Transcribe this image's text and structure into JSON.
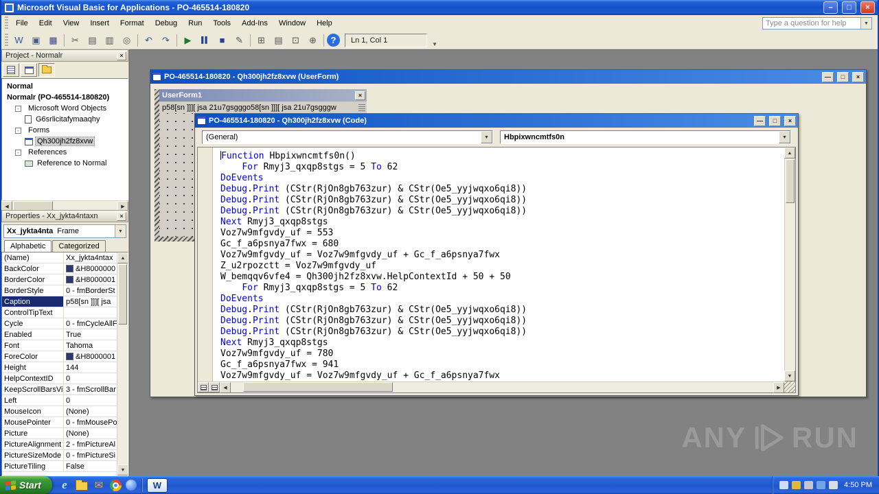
{
  "titlebar": {
    "title": "Microsoft Visual Basic for Applications - PO-465514-180820"
  },
  "menubar": {
    "items": [
      "File",
      "Edit",
      "View",
      "Insert",
      "Format",
      "Debug",
      "Run",
      "Tools",
      "Add-Ins",
      "Window",
      "Help"
    ],
    "help_placeholder": "Type a question for help"
  },
  "toolbar": {
    "caret_position": "Ln 1, Col 1",
    "buttons": [
      {
        "name": "view-host-application-button",
        "glyph": "W",
        "color": "#2b579a"
      },
      {
        "name": "insert-userform-button",
        "glyph": "▣",
        "color": "#4a5a8a"
      },
      {
        "name": "save-button",
        "glyph": "▦",
        "color": "#3a4a7a"
      },
      {
        "sep": true
      },
      {
        "name": "cut-button",
        "glyph": "✂",
        "color": "#555555"
      },
      {
        "name": "copy-button",
        "glyph": "▤",
        "color": "#555555"
      },
      {
        "name": "paste-button",
        "glyph": "▥",
        "color": "#555555"
      },
      {
        "name": "find-button",
        "glyph": "◎",
        "color": "#555555"
      },
      {
        "sep": true
      },
      {
        "name": "undo-button",
        "glyph": "↶",
        "color": "#2b579a"
      },
      {
        "name": "redo-button",
        "glyph": "↷",
        "color": "#2b579a"
      },
      {
        "sep": true
      },
      {
        "name": "run-button",
        "glyph": "▶",
        "color": "#1f7a2f"
      },
      {
        "name": "break-button",
        "glyph": "▌▌",
        "color": "#27408b"
      },
      {
        "name": "reset-button",
        "glyph": "■",
        "color": "#27408b"
      },
      {
        "name": "design-mode-button",
        "glyph": "✎",
        "color": "#555555"
      },
      {
        "sep": true
      },
      {
        "name": "project-explorer-button",
        "glyph": "⊞",
        "color": "#555555"
      },
      {
        "name": "properties-window-button",
        "glyph": "▤",
        "color": "#555555"
      },
      {
        "name": "object-browser-button",
        "glyph": "⊡",
        "color": "#555555"
      },
      {
        "name": "toolbox-button",
        "glyph": "⊕",
        "color": "#555555"
      },
      {
        "sep": true
      },
      {
        "name": "help-button",
        "glyph": "?",
        "color": "#ffffff"
      }
    ]
  },
  "project_panel": {
    "title": "Project - Normalr",
    "tree": [
      {
        "label": "Normal",
        "level": 0,
        "bold": true
      },
      {
        "label": "Normalr (PO-465514-180820)",
        "level": 0,
        "bold": true
      },
      {
        "label": "Microsoft Word Objects",
        "level": 1,
        "folder": true,
        "icon": "folder"
      },
      {
        "label": "G6srlicitafymaaqhy",
        "level": 2,
        "icon": "document"
      },
      {
        "label": "Forms",
        "level": 1,
        "folder": true,
        "icon": "folder"
      },
      {
        "label": "Qh300jh2fz8xvw",
        "level": 2,
        "icon": "form",
        "selected": true
      },
      {
        "label": "References",
        "level": 1,
        "folder": true,
        "icon": "folder"
      },
      {
        "label": "Reference to Normal",
        "level": 2,
        "icon": "reference"
      }
    ]
  },
  "properties_panel": {
    "title": "Properties - Xx_jykta4ntaxn",
    "object_name": "Xx_jykta4nta",
    "object_type": "Frame",
    "tabs": [
      "Alphabetic",
      "Categorized"
    ],
    "rows": [
      {
        "label": "(Name)",
        "value": "Xx_jykta4ntax"
      },
      {
        "label": "BackColor",
        "value": "&H8000000",
        "swatch": true
      },
      {
        "label": "BorderColor",
        "value": "&H8000001",
        "swatch": true
      },
      {
        "label": "BorderStyle",
        "value": "0 - fmBorderSt"
      },
      {
        "label": "Caption",
        "value": "p58[sn ]]][ jsa",
        "selected": true
      },
      {
        "label": "ControlTipText",
        "value": ""
      },
      {
        "label": "Cycle",
        "value": "0 - fmCycleAllF"
      },
      {
        "label": "Enabled",
        "value": "True"
      },
      {
        "label": "Font",
        "value": "Tahoma"
      },
      {
        "label": "ForeColor",
        "value": "&H8000001",
        "swatch": true
      },
      {
        "label": "Height",
        "value": "144"
      },
      {
        "label": "HelpContextID",
        "value": "0"
      },
      {
        "label": "KeepScrollBarsVi",
        "value": "3 - fmScrollBar"
      },
      {
        "label": "Left",
        "value": "0"
      },
      {
        "label": "MouseIcon",
        "value": "(None)"
      },
      {
        "label": "MousePointer",
        "value": "0 - fmMousePo"
      },
      {
        "label": "Picture",
        "value": "(None)"
      },
      {
        "label": "PictureAlignment",
        "value": "2 - fmPictureAl"
      },
      {
        "label": "PictureSizeMode",
        "value": "0 - fmPictureSi"
      },
      {
        "label": "PictureTiling",
        "value": "False"
      }
    ]
  },
  "userform_window": {
    "title": "PO-465514-180820 - Qh300jh2fz8xvw (UserForm)",
    "form_title": "UserForm1",
    "frame_caption": "p58[sn ]]][ jsa 21u7gsgggo58[sn ]]][ jsa 21u7gsgggw"
  },
  "code_window": {
    "title": "PO-465514-180820 - Qh300jh2fz8xvw (Code)",
    "object_combo": "(General)",
    "procedure_combo": "Hbpixwncmtfs0n",
    "lines": [
      "Function Hbpixwncmtfs0n()",
      "    For Rmyj3_qxqp8stgs = 5 To 62",
      "DoEvents",
      "Debug.Print (CStr(RjOn8gb763zur) & CStr(Oe5_yyjwqxo6qi8))",
      "Debug.Print (CStr(RjOn8gb763zur) & CStr(Oe5_yyjwqxo6qi8))",
      "Debug.Print (CStr(RjOn8gb763zur) & CStr(Oe5_yyjwqxo6qi8))",
      "Next Rmyj3_qxqp8stgs",
      "Voz7w9mfgvdy_uf = 553",
      "Gc_f_a6psnya7fwx = 680",
      "Voz7w9mfgvdy_uf = Voz7w9mfgvdy_uf + Gc_f_a6psnya7fwx",
      "Z_u2rpozctt = Voz7w9mfgvdy_uf",
      "W_bemqqv6vfe4 = Qh300jh2fz8xvw.HelpContextId + 50 + 50",
      "    For Rmyj3_qxqp8stgs = 5 To 62",
      "DoEvents",
      "Debug.Print (CStr(RjOn8gb763zur) & CStr(Oe5_yyjwqxo6qi8))",
      "Debug.Print (CStr(RjOn8gb763zur) & CStr(Oe5_yyjwqxo6qi8))",
      "Debug.Print (CStr(RjOn8gb763zur) & CStr(Oe5_yyjwqxo6qi8))",
      "Next Rmyj3_qxqp8stgs",
      "Voz7w9mfgvdy_uf = 780",
      "Gc_f_a6psnya7fwx = 941",
      "Voz7w9mfgvdy_uf = Voz7w9mfgvdy_uf + Gc_f_a6psnya7fwx"
    ]
  },
  "watermark": {
    "left": "ANY",
    "right": "RUN"
  },
  "taskbar": {
    "start_label": "Start",
    "quick_launch": [
      {
        "name": "internet-explorer-icon",
        "glyph": "e",
        "style": "ie"
      },
      {
        "name": "my-documents-folder-icon",
        "glyph": "",
        "style": "folder"
      },
      {
        "name": "outlook-mail-icon",
        "glyph": "✉",
        "style": "mail"
      },
      {
        "name": "chrome-icon",
        "glyph": "",
        "style": "chrome"
      },
      {
        "name": "messenger-icon",
        "glyph": "",
        "style": "sphere"
      }
    ],
    "word_task_glyph": "W",
    "tray_icons": [
      {
        "name": "language-bar-icon"
      },
      {
        "name": "security-center-icon"
      },
      {
        "name": "hardware-icon"
      },
      {
        "name": "network-status-icon"
      },
      {
        "name": "volume-icon"
      }
    ],
    "clock": "4:50 PM"
  }
}
